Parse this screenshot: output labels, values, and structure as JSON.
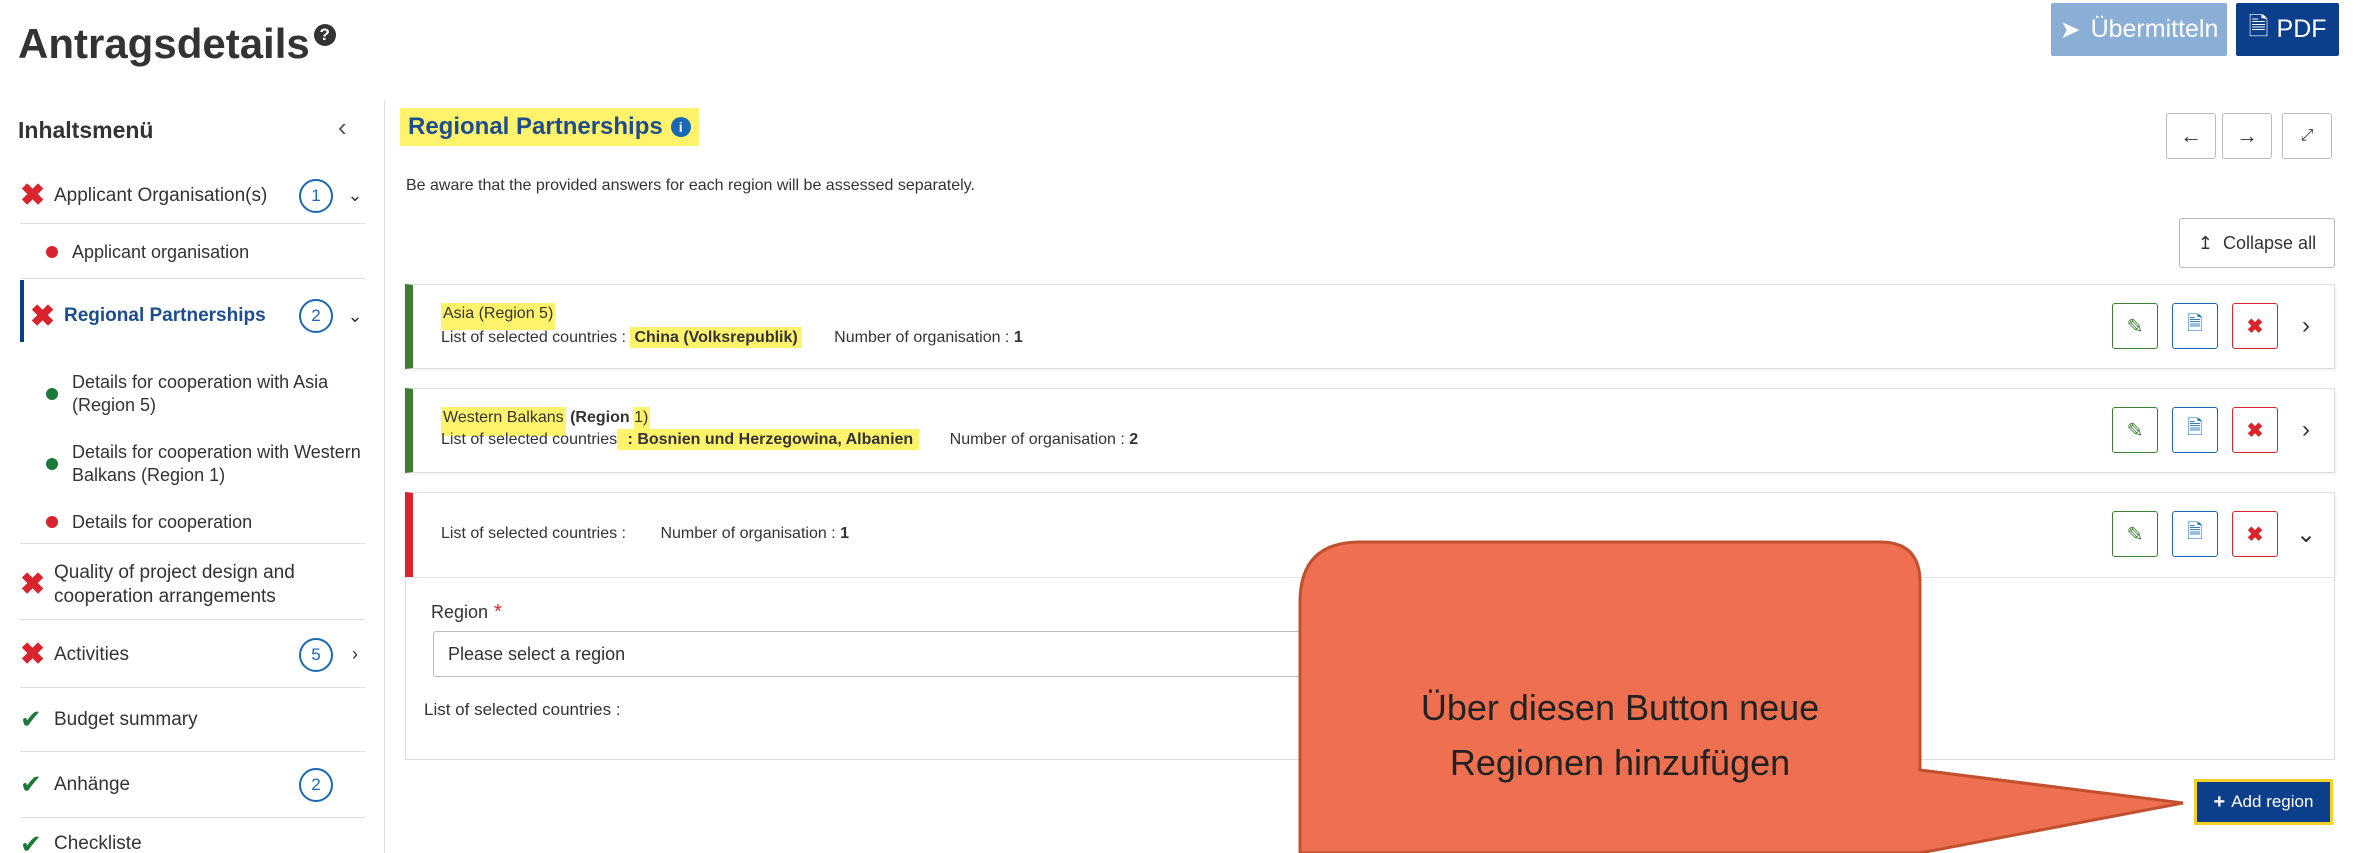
{
  "header": {
    "title": "Antragsdetails",
    "help_glyph": "?",
    "submit_label": "Übermitteln",
    "pdf_label": "PDF"
  },
  "sidebar": {
    "heading": "Inhaltsmenü",
    "items": [
      {
        "label": "Applicant Organisation(s)",
        "status": "error",
        "count": "1"
      },
      {
        "label": "Applicant organisation",
        "status": "error"
      },
      {
        "label": "Regional Partnerships",
        "status": "error",
        "count": "2"
      },
      {
        "label": "Details for cooperation with Asia (Region 5)",
        "status": "ok"
      },
      {
        "label": "Details for cooperation with Western Balkans (Region 1)",
        "status": "ok"
      },
      {
        "label": "Details for cooperation",
        "status": "error"
      },
      {
        "label": "Quality of project design and cooperation arrangements",
        "status": "error"
      },
      {
        "label": "Activities",
        "status": "error",
        "count": "5"
      },
      {
        "label": "Budget summary",
        "status": "ok"
      },
      {
        "label": "Anhänge",
        "status": "ok",
        "count": "2"
      },
      {
        "label": "Checkliste",
        "status": "ok"
      }
    ]
  },
  "main": {
    "section_title": "Regional Partnerships",
    "notice": "Be aware that the provided answers for each region will be assessed separately.",
    "collapse_label": "Collapse all",
    "cards": [
      {
        "title": "Asia (Region 5)",
        "countries_label": "List of selected countries :",
        "countries": "China (Volksrepublik)",
        "org_label": "Number of organisation :",
        "org_count": "1"
      },
      {
        "title_a": "Western Balkans",
        "title_b": " (Region ",
        "title_c": "1)",
        "countries_label": "List of selected countries",
        "countries": " : Bosnien und Herzegowina, Albanien",
        "org_label": "Number of organisation :",
        "org_count": "2"
      },
      {
        "countries_label": "List of selected countries :",
        "org_label": "Number of organisation :",
        "org_count": "1"
      }
    ],
    "form": {
      "region_label": "Region",
      "required_mark": "*",
      "region_placeholder": "Please select a region",
      "countries_label": "List of selected countries :"
    },
    "add_region_label": "Add region"
  },
  "callout": {
    "line1": "Über diesen Button neue",
    "line2": "Regionen hinzufügen"
  },
  "colors": {
    "primary": "#0b3f8c",
    "error": "#d9232d",
    "success": "#3f7d32",
    "highlight": "#fff36b",
    "callout_fill": "#ee7050",
    "callout_stroke": "#c0502e"
  },
  "icons": [
    "help-icon",
    "paper-plane-icon",
    "pdf-icon",
    "chevron-left-icon",
    "info-icon",
    "arrow-left-icon",
    "arrow-right-icon",
    "expand-icon",
    "collapse-up-icon",
    "pencil-icon",
    "document-icon",
    "close-icon",
    "chevron-right-icon",
    "chevron-down-icon",
    "plus-icon",
    "check-icon",
    "cross-icon"
  ]
}
